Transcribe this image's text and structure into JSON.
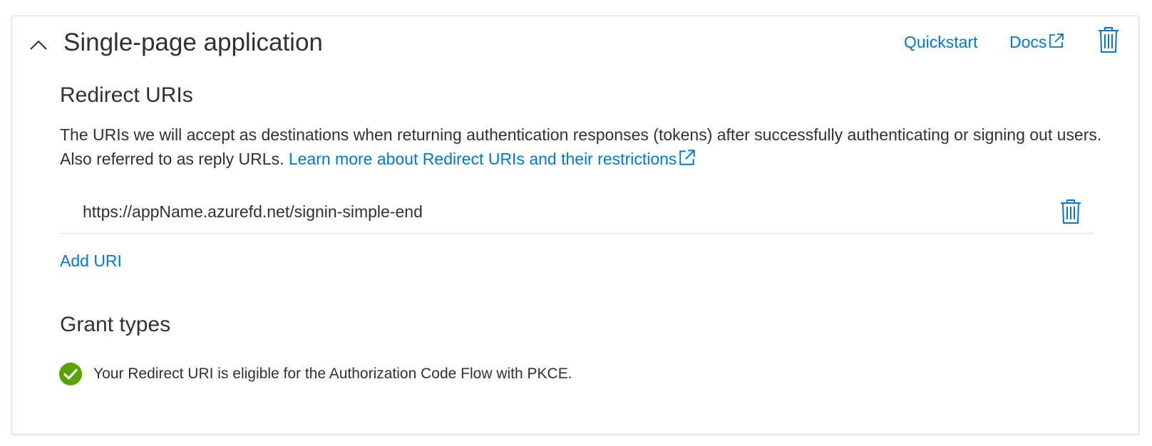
{
  "header": {
    "title": "Single-page application",
    "quickstart_label": "Quickstart",
    "docs_label": "Docs"
  },
  "redirect": {
    "heading": "Redirect URIs",
    "description": "The URIs we will accept as destinations when returning authentication responses (tokens) after successfully authenticating or signing out users. Also referred to as reply URLs.",
    "learn_more_label": "Learn more about Redirect URIs and their restrictions",
    "uris": [
      "https://appName.azurefd.net/signin-simple-end"
    ],
    "add_uri_label": "Add URI"
  },
  "grant": {
    "heading": "Grant types",
    "eligible_text": "Your Redirect URI is eligible for the Authorization Code Flow with PKCE."
  },
  "icons": {
    "collapse": "chevron-up-icon",
    "external": "external-link-icon",
    "delete": "trash-icon",
    "status": "check-circle-icon"
  },
  "colors": {
    "link": "#0078d4",
    "text": "#323130",
    "success": "#57a300",
    "border": "#dcdcdc"
  }
}
